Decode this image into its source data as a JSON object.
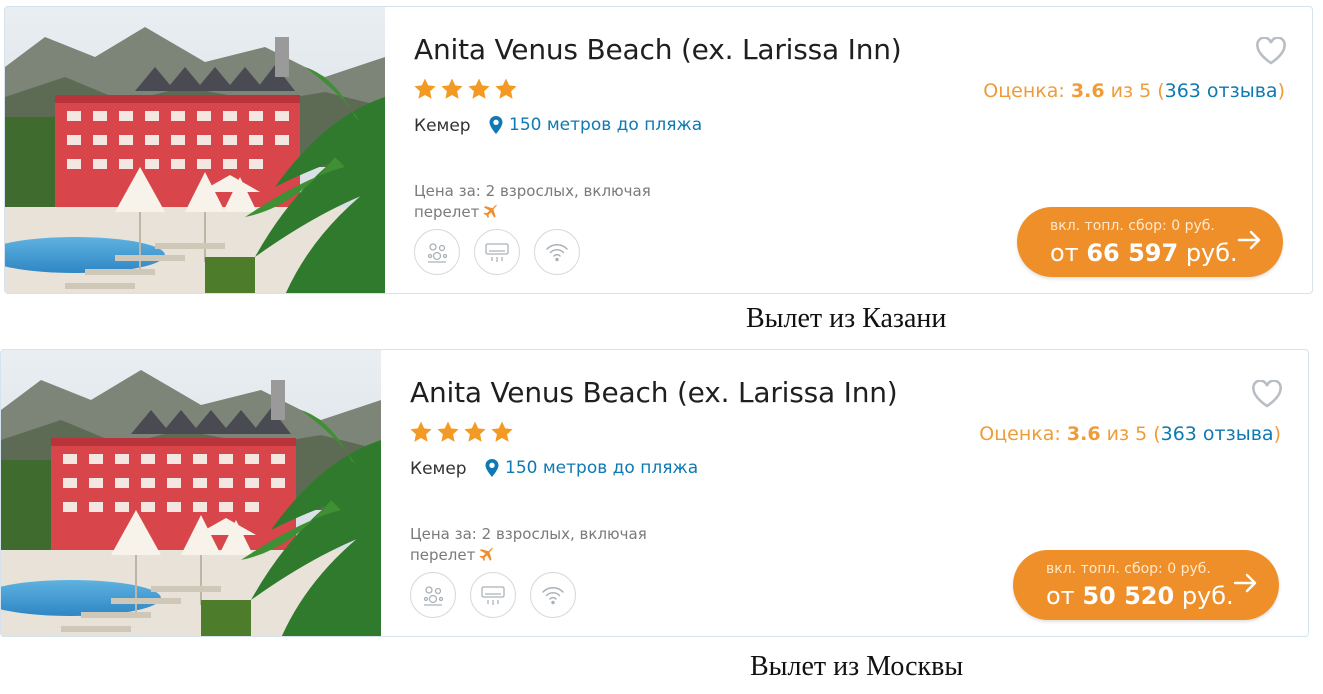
{
  "cards": [
    {
      "hotel_name": "Anita Venus Beach (ex. Larissa Inn)",
      "stars": 4,
      "city": "Кемер",
      "beach_distance": "150 метров до пляжа",
      "price_note_line1": "Цена за: 2 взрослых, включая",
      "price_note_line2": "перелет",
      "amenities": [
        "kids-club-icon",
        "air-conditioner-icon",
        "wifi-icon"
      ],
      "rating_label": "Оценка:",
      "rating_value": "3.6",
      "rating_of": "из 5 (",
      "reviews": "363 отзыва",
      "rating_close": ")",
      "fee_note": "вкл. топл. сбор: 0 руб.",
      "price_prefix": "от",
      "price_value": "66 597",
      "price_currency": "руб.",
      "caption": "Вылет из Казани"
    },
    {
      "hotel_name": "Anita Venus Beach (ex. Larissa Inn)",
      "stars": 4,
      "city": "Кемер",
      "beach_distance": "150 метров до пляжа",
      "price_note_line1": "Цена за: 2 взрослых, включая",
      "price_note_line2": "перелет",
      "amenities": [
        "kids-club-icon",
        "air-conditioner-icon",
        "wifi-icon"
      ],
      "rating_label": "Оценка:",
      "rating_value": "3.6",
      "rating_of": "из 5 (",
      "reviews": "363 отзыва",
      "rating_close": ")",
      "fee_note": "вкл. топл. сбор: 0 руб.",
      "price_prefix": "от",
      "price_value": "50 520",
      "price_currency": "руб.",
      "caption": "Вылет из Москвы"
    }
  ],
  "colors": {
    "accent_orange": "#ef8f2a",
    "rating_orange": "#ef9c38",
    "link_blue": "#0e79b2",
    "star_orange": "#f39a24"
  }
}
